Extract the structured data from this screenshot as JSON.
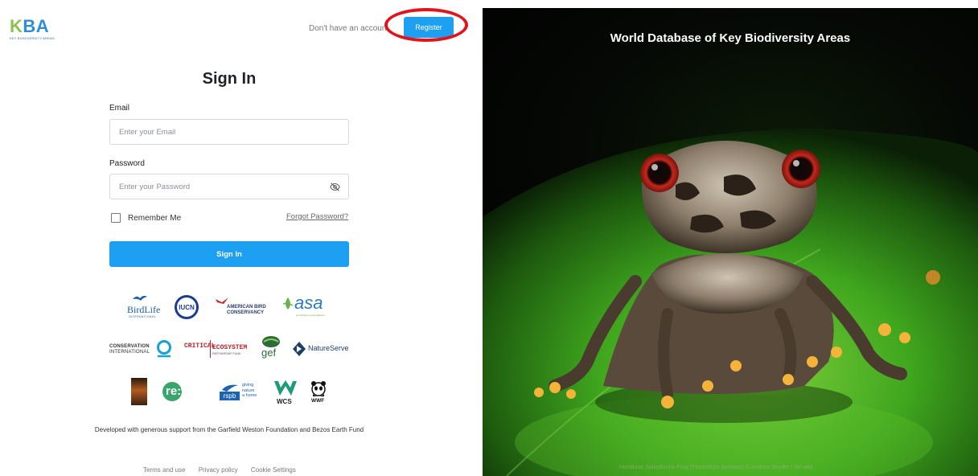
{
  "header": {
    "logo_text_k": "K",
    "logo_text_ba": "BA",
    "logo_subtitle": "KEY BIODIVERSITY AREAS",
    "account_prompt": "Don't have an accoun",
    "register_label": "Register"
  },
  "form": {
    "title": "Sign In",
    "email_label": "Email",
    "email_placeholder": "Enter your Email",
    "password_label": "Password",
    "password_placeholder": "Enter your Password",
    "remember_label": "Remember Me",
    "forgot_label": "Forgot Password?",
    "submit_label": "Sign In"
  },
  "partners": {
    "birdlife": "BirdLife",
    "birdlife_sub": "INTERNATIONAL",
    "iucn": "IUCN",
    "abc_line1": "AMERICAN BIRD",
    "abc_line2": "CONSERVANCY",
    "asa": "asa",
    "asa_sub": "amphibian survival alliance",
    "ci_line1": "CONSERVATION",
    "ci_line2": "INTERNATIONAL",
    "cepf_line1": "CRITICAL",
    "cepf_line2": "ECOSYSTEM",
    "cepf_sub": "PARTNERSHIP FUND",
    "gef": "gef",
    "natureserve": "NatureServe",
    "rewild": "re:wild",
    "rspb": "rspb",
    "rspb_tag1": "giving",
    "rspb_tag2": "nature",
    "rspb_tag3": "a home",
    "wcs": "WCS",
    "wwf": "WWF"
  },
  "support_text": "Developed with generous support from the Garfield Weston Foundation and Bezos Earth Fund",
  "footer": {
    "terms": "Terms and use",
    "privacy": "Privacy policy",
    "cookies": "Cookie Settings"
  },
  "hero": {
    "title": "World Database of Key Biodiversity Areas",
    "caption": "Honduras Spikethumb Frog (Plectrohyla dasypus) © Andrew Snyder / Re:wild"
  },
  "colors": {
    "accent": "#1ea0f2",
    "highlight_ring": "#e0141a"
  }
}
